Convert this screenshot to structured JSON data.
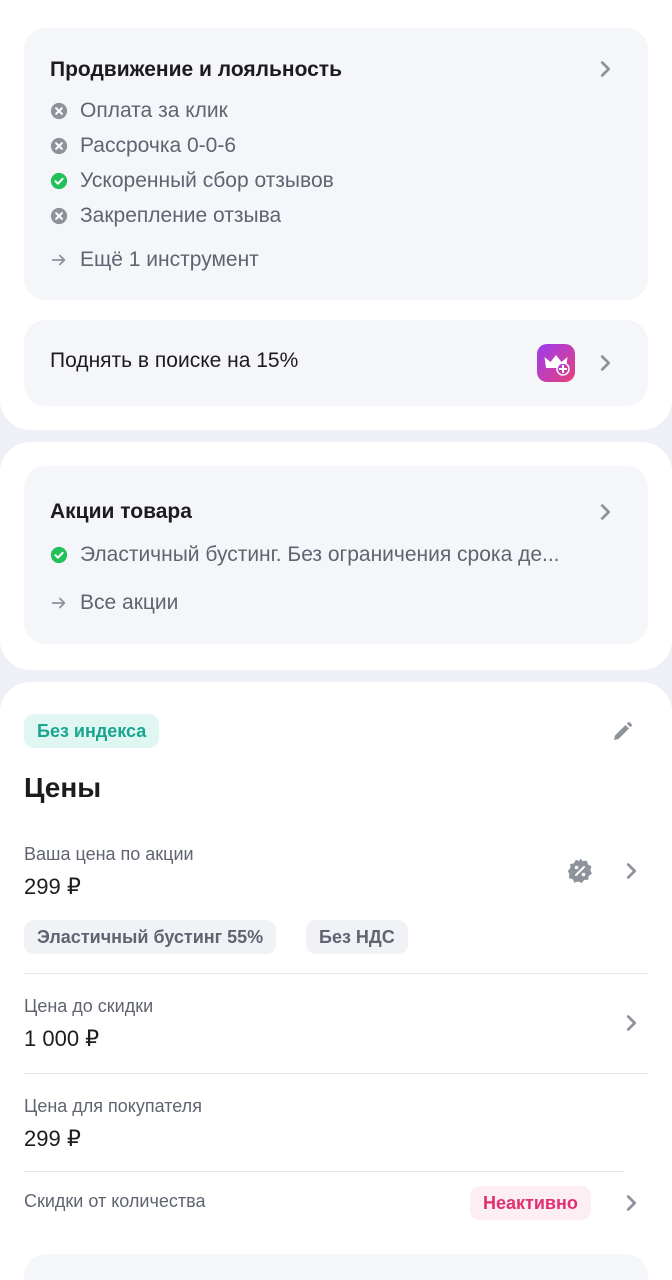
{
  "promotion": {
    "title": "Продвижение и лояльность",
    "items": [
      {
        "label": "Оплата за клик",
        "status": "off"
      },
      {
        "label": "Рассрочка 0-0-6",
        "status": "off"
      },
      {
        "label": "Ускоренный сбор отзывов",
        "status": "on"
      },
      {
        "label": "Закрепление отзыва",
        "status": "off"
      }
    ],
    "more_label": "Ещё 1 инструмент",
    "icons": {
      "off": "x-circle-icon",
      "on": "check-circle-icon"
    }
  },
  "boost": {
    "label": "Поднять в поиске на 15%",
    "icon": "crown-plus-icon"
  },
  "actions": {
    "title": "Акции товара",
    "active_item": "Эластичный бустинг. Без ограничения срока де...",
    "all_label": "Все акции"
  },
  "prices": {
    "index_badge": "Без индекса",
    "title": "Цены",
    "promo_price_label": "Ваша цена по акции",
    "promo_price_value": "299 ₽",
    "tags": [
      "Эластичный бустинг 55%",
      "Без НДС"
    ],
    "before_discount_label": "Цена до скидки",
    "before_discount_value": "1 000 ₽",
    "buyer_price_label": "Цена для покупателя",
    "buyer_price_value": "299 ₽",
    "qty_discount_label": "Скидки от количества",
    "qty_discount_status": "Неактивно"
  },
  "colors": {
    "green": "#22c05a",
    "gray_icon": "#8e929c",
    "teal_badge_bg": "#e0f6f3",
    "teal_badge_text": "#1aa591",
    "pink_badge_bg": "#fdeef3",
    "pink_badge_text": "#e0306f",
    "boost_gradient_start": "#9b3cf0",
    "boost_gradient_end": "#e8407a"
  }
}
